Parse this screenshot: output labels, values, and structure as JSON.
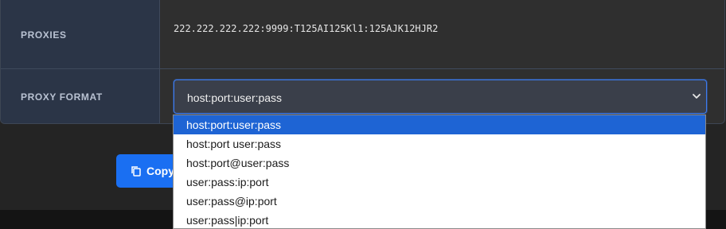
{
  "rows": {
    "proxies_label": "PROXIES",
    "proxies_value": "222.222.222.222:9999:T125AI125Kl1:125AJK12HJR2",
    "format_label": "PROXY FORMAT"
  },
  "select": {
    "value": "host:port:user:pass",
    "options": [
      "host:port:user:pass",
      "host:port user:pass",
      "host:port@user:pass",
      "user:pass:ip:port",
      "user:pass@ip:port",
      "user:pass|ip:port"
    ],
    "selected_index": 0
  },
  "copy_button": {
    "label": "Copy",
    "icon": "copy-icon"
  },
  "colors": {
    "accent": "#1a6ff2",
    "highlight": "#1e64d4",
    "label_bg": "#2b3547",
    "page_bg": "#242424"
  }
}
